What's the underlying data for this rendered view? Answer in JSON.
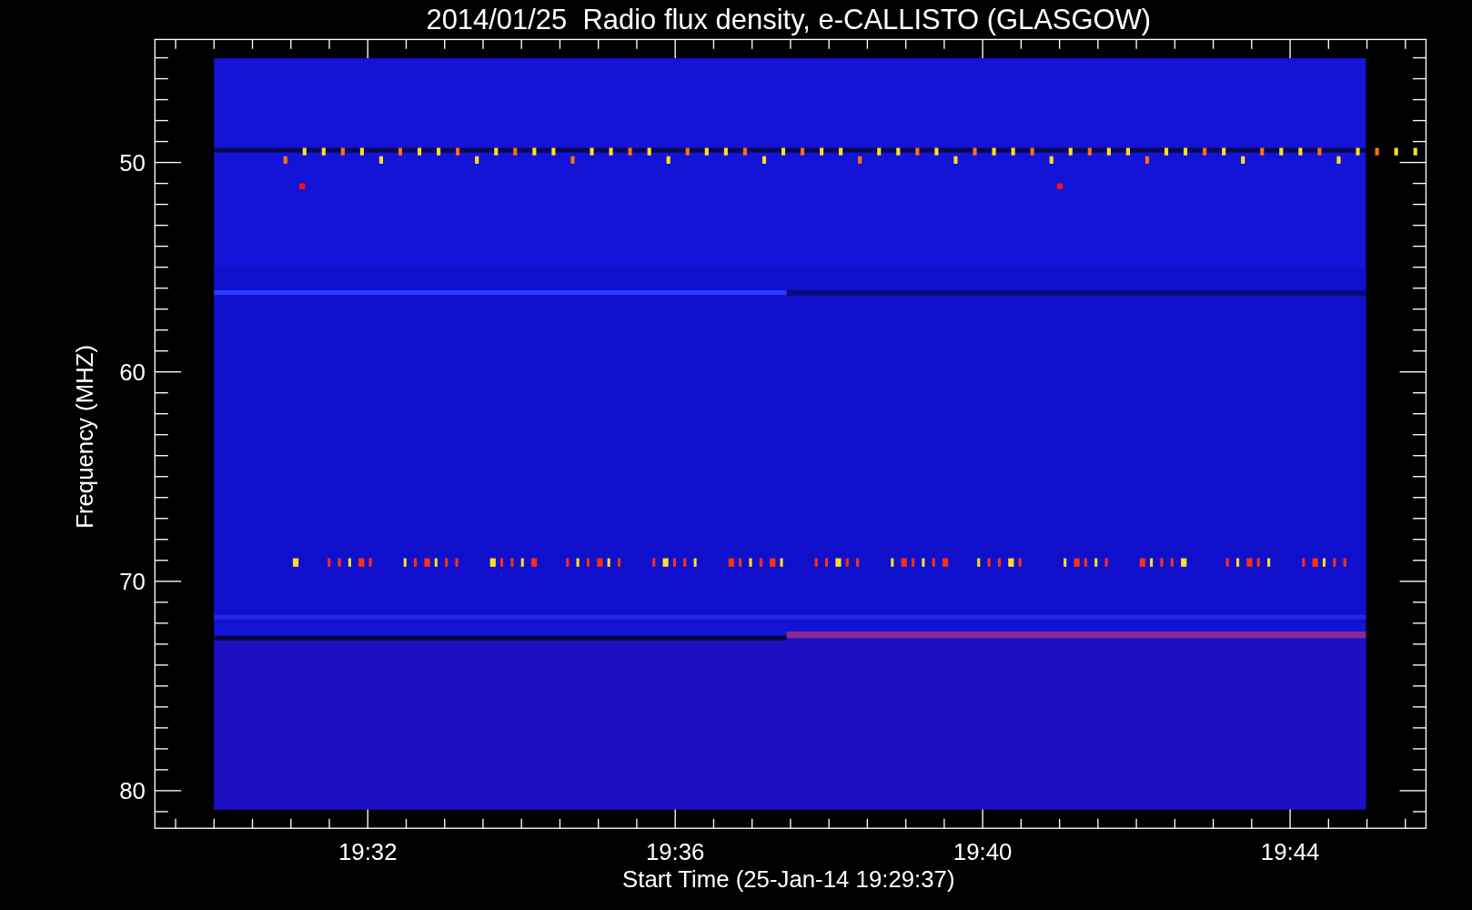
{
  "plot": {
    "title": "2014/01/25  Radio flux density, e-CALLISTO (GLASGOW)",
    "ylabel": "Frequency (MHZ)",
    "xlabel": "Start Time (25-Jan-14 19:29:37)",
    "yticks": [
      "50",
      "60",
      "70",
      "80"
    ],
    "xticks": [
      "19:32",
      "19:36",
      "19:40",
      "19:44"
    ]
  }
}
